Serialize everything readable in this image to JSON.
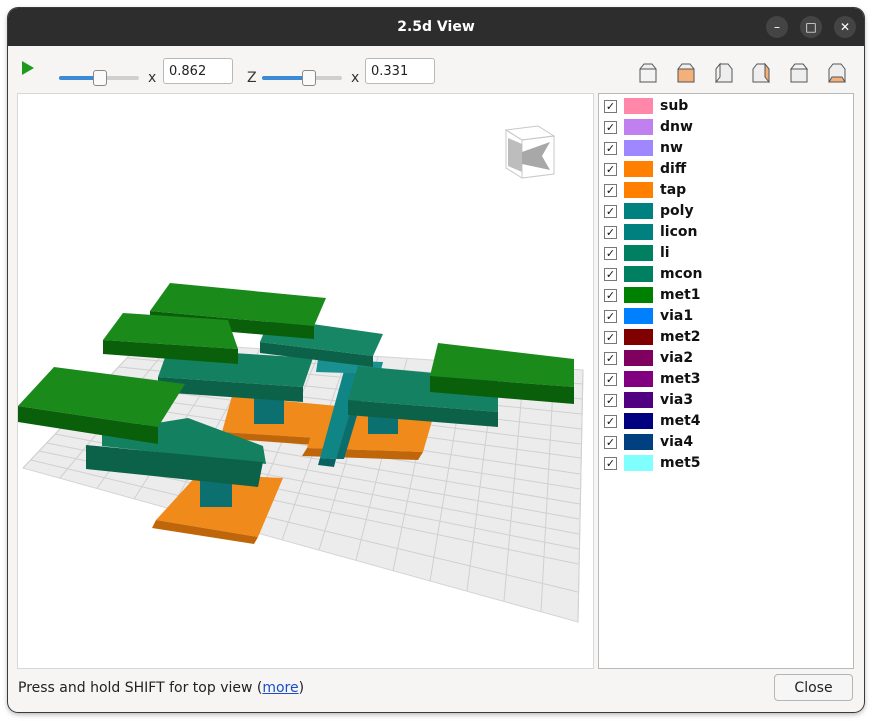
{
  "window": {
    "title": "2.5d View"
  },
  "window_buttons": {
    "minimize": "–",
    "maximize": "□",
    "close": "✕"
  },
  "toolbar": {
    "x_label": "x",
    "x_value": "0.862",
    "z_label": "Z",
    "z_x_label": "x",
    "z_value": "0.331",
    "x_slider_level": 0.5,
    "z_slider_level": 0.58
  },
  "layers": [
    {
      "name": "sub",
      "color": "#ff88aa",
      "checked": true
    },
    {
      "name": "dnw",
      "color": "#c080f0",
      "checked": true
    },
    {
      "name": "nw",
      "color": "#9f88ff",
      "checked": true
    },
    {
      "name": "diff",
      "color": "#ff8000",
      "checked": true
    },
    {
      "name": "tap",
      "color": "#ff8000",
      "checked": true
    },
    {
      "name": "poly",
      "color": "#00807f",
      "checked": true
    },
    {
      "name": "licon",
      "color": "#00807f",
      "checked": true
    },
    {
      "name": "li",
      "color": "#008060",
      "checked": true
    },
    {
      "name": "mcon",
      "color": "#008060",
      "checked": true
    },
    {
      "name": "met1",
      "color": "#008000",
      "checked": true
    },
    {
      "name": "via1",
      "color": "#0080ff",
      "checked": true
    },
    {
      "name": "met2",
      "color": "#800000",
      "checked": true
    },
    {
      "name": "via2",
      "color": "#800060",
      "checked": true
    },
    {
      "name": "met3",
      "color": "#800080",
      "checked": true
    },
    {
      "name": "via3",
      "color": "#500080",
      "checked": true
    },
    {
      "name": "met4",
      "color": "#000080",
      "checked": true
    },
    {
      "name": "via4",
      "color": "#004080",
      "checked": true
    },
    {
      "name": "met5",
      "color": "#80ffff",
      "checked": true
    }
  ],
  "status": {
    "text": "Press and hold SHIFT for top view (",
    "link": "more",
    "suffix": ")"
  },
  "buttons": {
    "close": "Close"
  },
  "icons": [
    "play-icon",
    "front-view-icon",
    "back-view-icon",
    "left-view-icon",
    "right-view-icon",
    "top-view-icon",
    "bottom-view-icon",
    "klayout-cube-icon",
    "checkbox-check-icon"
  ],
  "colors": {
    "accent": "#3c89d6",
    "diff": "#e87b06",
    "li": "#0b7a5a",
    "met1": "#0a7a0a",
    "poly": "#0a7c7c",
    "grid": "#d8d8d8"
  }
}
